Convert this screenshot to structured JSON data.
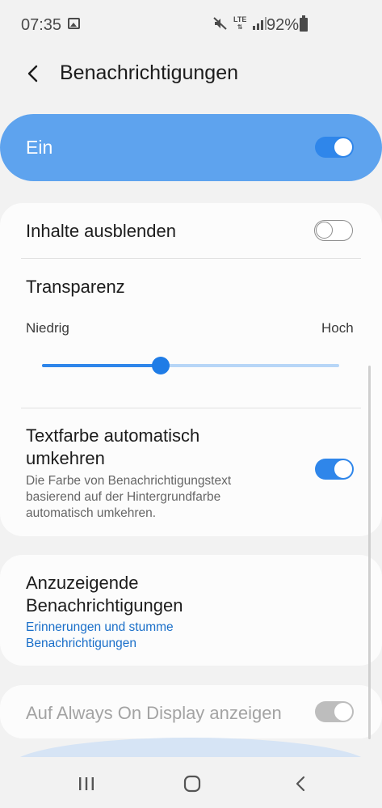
{
  "status_bar": {
    "time": "07:35",
    "network_type": "LTE",
    "battery_percent": "92%",
    "icons": [
      "gallery-icon",
      "mute-icon",
      "lte-icon",
      "signal-icon",
      "battery-icon"
    ]
  },
  "header": {
    "back_icon": "chevron-left-icon",
    "title": "Benachrichtigungen"
  },
  "master_switch": {
    "label": "Ein",
    "enabled": true,
    "accent_color": "#5ea3ee"
  },
  "settings": {
    "hide_content": {
      "label": "Inhalte ausblenden",
      "enabled": false
    },
    "transparency": {
      "label": "Transparenz",
      "min_label": "Niedrig",
      "max_label": "Hoch",
      "level": 0.4
    },
    "invert_text_color": {
      "title_line1": "Textfarbe automatisch",
      "title_line2": "umkehren",
      "summary_line1": "Die Farbe von Benachrichtigungstext",
      "summary_line2": "basierend auf der Hintergrundfarbe",
      "summary_line3": "automatisch umkehren.",
      "enabled": true
    },
    "notifications_to_show": {
      "title_line1": "Anzuzeigende",
      "title_line2": "Benachrichtigungen",
      "value_line1": "Erinnerungen und stumme",
      "value_line2": "Benachrichtigungen",
      "value_color": "#1a6fc9"
    },
    "always_on_display": {
      "label": "Auf Always On Display anzeigen",
      "enabled": true,
      "disabled": true
    }
  },
  "nav_bar": {
    "icons": [
      "recent-apps-icon",
      "home-icon",
      "back-icon"
    ]
  },
  "colors": {
    "toggle_on": "#2f86ea",
    "background": "#f2f2f2",
    "card": "#fcfcfc"
  }
}
